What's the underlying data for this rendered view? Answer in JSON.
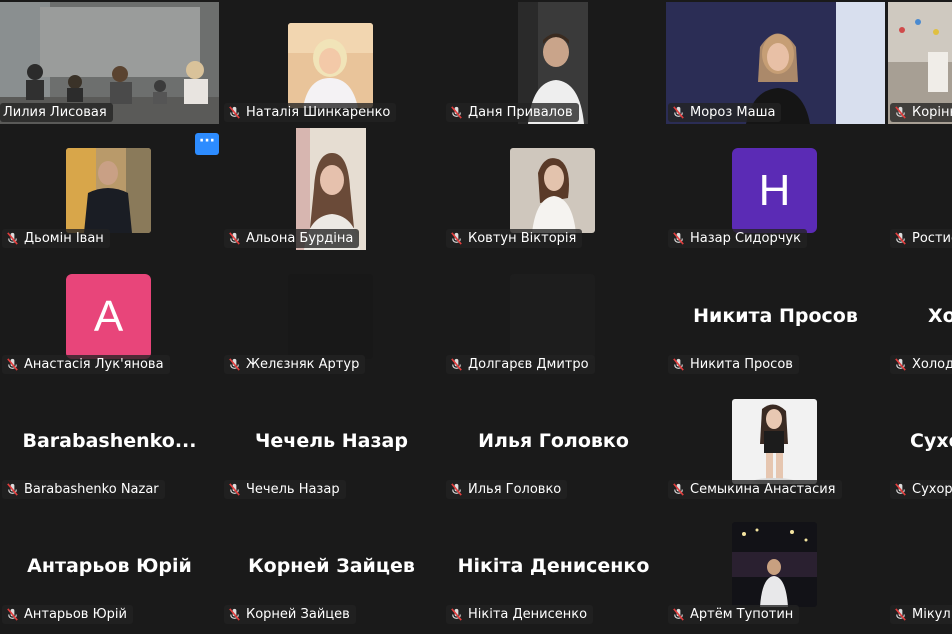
{
  "app": "Zoom meeting gallery view",
  "colors": {
    "active_speaker_border": "#23d959",
    "muted_mic": "#e23d3d",
    "more_button": "#2d8cff"
  },
  "more_button": {
    "label": "···"
  },
  "tiles": [
    {
      "name": "Лилия Лисовая",
      "type": "video",
      "active": true
    },
    {
      "name": "Наталія Шинкаренко",
      "type": "photo"
    },
    {
      "name": "Даня Привалов",
      "type": "video"
    },
    {
      "name": "Мороз Маша",
      "type": "video"
    },
    {
      "name": "Корінн",
      "type": "video"
    },
    {
      "name": "Дьомін Іван",
      "type": "photo"
    },
    {
      "name": "Альона Бурдіна",
      "type": "video"
    },
    {
      "name": "Ковтун Вікторія",
      "type": "photo"
    },
    {
      "name": "Назар Сидорчук",
      "type": "letter",
      "letter": "H",
      "avatar_color": "#5b2bb5"
    },
    {
      "name": "Ростис",
      "type": "blank"
    },
    {
      "name": "Анастасія Лук'янова",
      "type": "letter",
      "letter": "A",
      "avatar_color": "#e8457a"
    },
    {
      "name": "Желєзняк Артур",
      "type": "dark"
    },
    {
      "name": "Долгарєв Дмитро",
      "type": "dark"
    },
    {
      "name": "Никита Просов",
      "type": "text",
      "big": "Никита Просов"
    },
    {
      "name": "Холод",
      "type": "text",
      "big": "Хо"
    },
    {
      "name": "Barabashenko Nazar",
      "type": "text",
      "big": "Barabashenko..."
    },
    {
      "name": "Чечель Назар",
      "type": "text",
      "big": "Чечель Назар"
    },
    {
      "name": "Илья Головко",
      "type": "text",
      "big": "Илья Головко"
    },
    {
      "name": "Семыкина Анастасия",
      "type": "photo"
    },
    {
      "name": "Сухору",
      "type": "text",
      "big": "Сухо"
    },
    {
      "name": "Антарьов Юрій",
      "type": "text",
      "big": "Антарьов Юрій"
    },
    {
      "name": "Корней Зайцев",
      "type": "text",
      "big": "Корней Зайцев"
    },
    {
      "name": "Нікіта Денисенко",
      "type": "text",
      "big": "Нікіта Денисенко"
    },
    {
      "name": "Артём Тупотин",
      "type": "photo"
    },
    {
      "name": "Мікул",
      "type": "text",
      "big": ""
    }
  ]
}
